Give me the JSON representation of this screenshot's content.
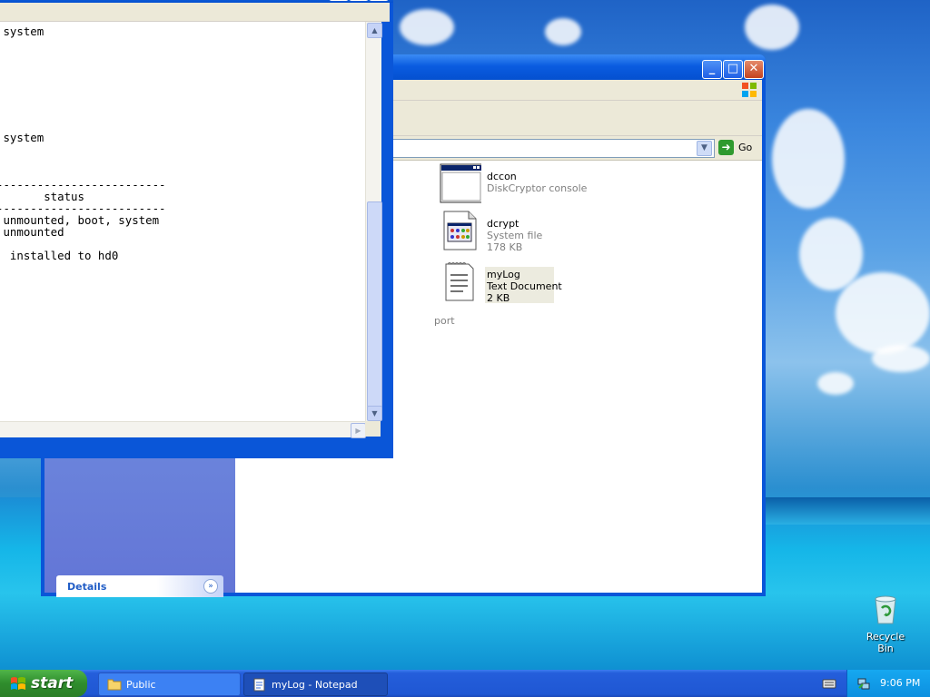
{
  "notepad": {
    "text_lines": [
      " system",
      "",
      "",
      "",
      "",
      "",
      "",
      "",
      "",
      " system",
      "",
      "",
      "",
      "-------------------------",
      "       status",
      "-------------------------",
      " unmounted, boot, system",
      " unmounted",
      "",
      "  installed to hd0"
    ]
  },
  "explorer": {
    "address_go_label": "Go",
    "details_label": "Details",
    "partial_task_text": "port",
    "files": [
      {
        "name": "dccon",
        "line1": "DiskCryptor console",
        "line2": "",
        "icon": "console-app-icon"
      },
      {
        "name": "dcrypt",
        "line1": "System file",
        "line2": "178 KB",
        "icon": "system-file-icon"
      },
      {
        "name": "myLog",
        "line1": "Text Document",
        "line2": "2 KB",
        "icon": "text-document-icon"
      }
    ]
  },
  "desktop": {
    "recycle_bin_label": "Recycle Bin"
  },
  "taskbar": {
    "start_label": "start",
    "tasks": [
      {
        "label": "Public",
        "icon": "folder-icon"
      },
      {
        "label": "myLog - Notepad",
        "icon": "notepad-icon"
      }
    ],
    "clock": "9:06 PM"
  }
}
